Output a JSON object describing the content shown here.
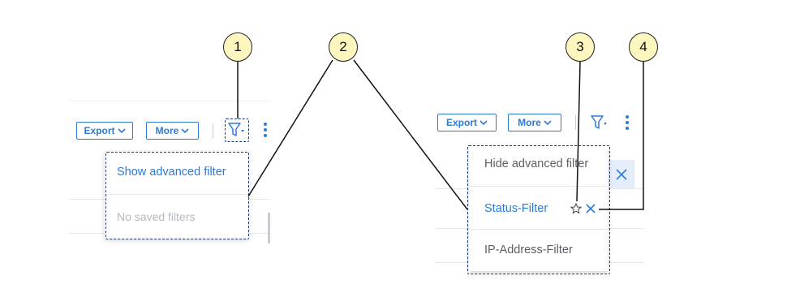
{
  "left_panel": {
    "toolbar": {
      "export_label": "Export",
      "more_label": "More"
    },
    "menu": {
      "items": [
        {
          "label": "Show advanced filter",
          "state": "active"
        },
        {
          "label": "No saved filters",
          "state": "disabled"
        }
      ]
    }
  },
  "right_panel": {
    "toolbar": {
      "export_label": "Export",
      "more_label": "More"
    },
    "menu": {
      "items": [
        {
          "label": "Hide advanced filter",
          "state": "normal"
        },
        {
          "label": "Status-Filter",
          "state": "active"
        },
        {
          "label": "IP-Address-Filter",
          "state": "normal"
        }
      ]
    }
  },
  "callouts": [
    "1",
    "2",
    "3",
    "4"
  ],
  "colors": {
    "accent": "#2a7bd8",
    "callout_fill": "#fdf7bf",
    "dashed_border": "#1f3f73",
    "disabled_text": "#b5b9bf",
    "normal_text": "#5a5f66"
  },
  "icons": [
    "chevron-down-icon",
    "filter-icon",
    "kebab-menu-icon",
    "star-outline-icon",
    "close-icon"
  ]
}
